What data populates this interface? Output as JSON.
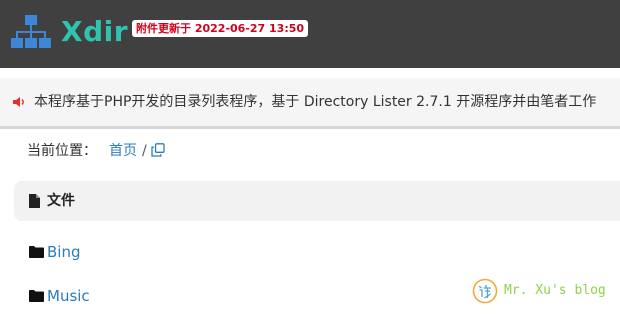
{
  "header": {
    "logo_text": "Xdir",
    "update_badge": "附件更新于 2022-06-27 13:50"
  },
  "notice": {
    "icon": "speaker-icon",
    "text": "本程序基于PHP开发的目录列表程序，基于 Directory Lister 2.7.1 开源程序并由笔者工作"
  },
  "breadcrumb": {
    "label": "当前位置：",
    "home": "首页",
    "separator": "/"
  },
  "file_list": {
    "header_label": "文件",
    "items": [
      {
        "name": "Bing",
        "icon": "folder-icon"
      },
      {
        "name": "Music",
        "icon": "folder-icon"
      }
    ]
  },
  "watermark": {
    "text": "Mr. Xu's blog"
  },
  "colors": {
    "header_bg": "#404040",
    "logo_accent": "#2ec4b0",
    "badge_text": "#d0021b",
    "link": "#2b7bbf",
    "notice_bg": "#f5f5f5",
    "watermark": "#8fd24a"
  }
}
